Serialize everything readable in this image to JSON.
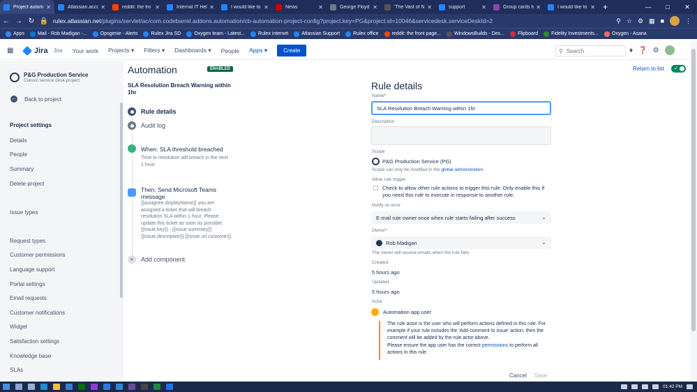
{
  "browser": {
    "tabs": [
      {
        "label": "Project autom",
        "active": true,
        "color": "#2684ff"
      },
      {
        "label": "Atlassian.acco",
        "active": false,
        "color": "#2684ff"
      },
      {
        "label": "reddit: the fro",
        "active": false,
        "color": "#ff4500"
      },
      {
        "label": "Internal IT Hel",
        "active": false,
        "color": "#2684ff"
      },
      {
        "label": "I would like to",
        "active": false,
        "color": "#2684ff"
      },
      {
        "label": "News",
        "active": false,
        "color": "#cc0000"
      },
      {
        "label": "George Floyd ",
        "active": false,
        "color": "#6b778c"
      },
      {
        "label": "'The Vast of N",
        "active": false,
        "color": "#555555"
      },
      {
        "label": "support",
        "active": false,
        "color": "#2684ff"
      },
      {
        "label": "Group cards fo",
        "active": false,
        "color": "#8e44ad"
      },
      {
        "label": "I would like to",
        "active": false,
        "color": "#2684ff"
      }
    ],
    "url_host": "rulex.atlassian.net",
    "url_path": "/plugins/servlet/ac/com.codebarrel.addons.automation/cb-automation-project-config?project.key=PG&project.id=10046&servicedesk.serviceDeskId=2",
    "bookmarks": [
      {
        "label": "Apps",
        "color": "#4285f4"
      },
      {
        "label": "Mail - Rob Madigan -...",
        "color": "#0078d4"
      },
      {
        "label": "Opsgenie - Alerts",
        "color": "#2684ff"
      },
      {
        "label": "Rulex Jira SD",
        "color": "#2684ff"
      },
      {
        "label": "Oxygen team - Latest...",
        "color": "#2684ff"
      },
      {
        "label": "Rulex internet",
        "color": "#2684ff"
      },
      {
        "label": "Atlassian Support",
        "color": "#2684ff"
      },
      {
        "label": "Rulex office",
        "color": "#2684ff"
      },
      {
        "label": "reddit: the front page...",
        "color": "#ff4500"
      },
      {
        "label": "WindowsBuilds - Des...",
        "color": "#555555"
      },
      {
        "label": "Flipboard",
        "color": "#e12828"
      },
      {
        "label": "Fidelity Investments...",
        "color": "#368727"
      },
      {
        "label": "Oxygen - Asana",
        "color": "#f06a6a"
      }
    ]
  },
  "jira": {
    "brand": "Jira",
    "sub": "Jira",
    "nav": [
      "Your work",
      "Projects",
      "Filters",
      "Dashboards",
      "People",
      "Apps"
    ],
    "create": "Create",
    "search_placeholder": "Search"
  },
  "sidebar": {
    "project_name": "P&G Production Service",
    "project_type": "Classic service desk project",
    "back": "Back to project",
    "items": [
      {
        "label": "Project settings",
        "head": true
      },
      {
        "label": "Details"
      },
      {
        "label": "People"
      },
      {
        "label": "Summary"
      },
      {
        "label": "Delete project"
      },
      {
        "label": "Issue types"
      },
      {
        "label": "Request types"
      },
      {
        "label": "Customer permissions"
      },
      {
        "label": "Language support"
      },
      {
        "label": "Portal settings"
      },
      {
        "label": "Email requests"
      },
      {
        "label": "Customer notifications"
      },
      {
        "label": "Widget"
      },
      {
        "label": "Satisfaction settings"
      },
      {
        "label": "Knowledge base"
      },
      {
        "label": "SLAs"
      }
    ]
  },
  "workflow": {
    "title": "Automation",
    "badge": "ENABLED",
    "rule_name": "SLA Resolution Breach Warning within 1hr",
    "tabs": [
      "Rule details",
      "Audit log"
    ],
    "trigger_title": "When: SLA threshold breached",
    "trigger_desc": "Time to resolution will breach in the next 1 hour",
    "action_title": "Then: Send Microsoft Teams message",
    "action_desc": "{{assignee.displayName}} you are assigned a ticket that will breach resolution SLA within 1 hour. Please update this ticket as soon as possible. {{issue.key}} - {{issue.summary}} {{issue.description}} {{issue.url.customer}}",
    "add_component": "Add component"
  },
  "details": {
    "heading": "Rule details",
    "return": "Return to list",
    "toggle_mark": "✓",
    "name_label": "Name",
    "name_value": "SLA Resolution Breach Warning within 1hr",
    "desc_label": "Description",
    "scope_label": "Scope",
    "scope_value": "P&G Production Service (PG)",
    "scope_note": "Scope can only be modified in the",
    "scope_link": "global administration.",
    "allow_label": "Allow rule trigger",
    "allow_text": "Check to allow other rule actions to trigger this rule. Only enable this if you need this rule to execute in response to another rule.",
    "notify_label": "Notify on error",
    "notify_value": "E-mail rule owner once when rule starts failing after success",
    "owner_label": "Owner",
    "owner_value": "Rob Madigan",
    "owner_note": "The owner will receive emails when the rule fails.",
    "created_label": "Created",
    "created_value": "5 hours ago",
    "updated_label": "Updated",
    "updated_value": "5 hours ago",
    "actor_label": "Actor",
    "actor_value": "Automation app user",
    "actor_info": "The rule actor is the user who will perform actions defined in this rule. For example if your rule includes the 'Add comment to issue' action, then the comment will be added by the rule actor above.",
    "actor_perm_pre": "Please ensure the app user has the correct",
    "actor_perm_link": "permissions",
    "actor_perm_post": "to perform all actions in this rule.",
    "cancel": "Cancel",
    "save": "Save"
  },
  "taskbar": {
    "time": "01:42 PM"
  }
}
